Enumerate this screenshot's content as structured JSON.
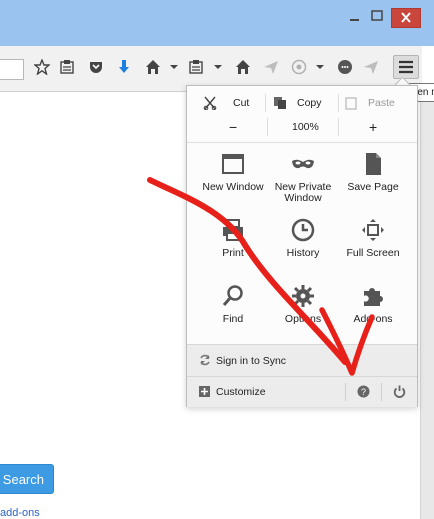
{
  "tooltip": {
    "text": "Open menu"
  },
  "page": {
    "search_button": "Search",
    "addons_link": "add-ons"
  },
  "menu": {
    "edit": {
      "cut": "Cut",
      "copy": "Copy",
      "paste": "Paste"
    },
    "zoom": {
      "minus": "−",
      "level": "100%",
      "plus": "+"
    },
    "items": [
      {
        "label": "New Window",
        "icon": "window-icon"
      },
      {
        "label": "New Private Window",
        "icon": "mask-icon"
      },
      {
        "label": "Save Page",
        "icon": "page-icon"
      },
      {
        "label": "Print",
        "icon": "printer-icon"
      },
      {
        "label": "History",
        "icon": "clock-icon"
      },
      {
        "label": "Full Screen",
        "icon": "fullscreen-icon"
      },
      {
        "label": "Find",
        "icon": "magnifier-icon"
      },
      {
        "label": "Options",
        "icon": "gear-icon"
      },
      {
        "label": "Add-ons",
        "icon": "puzzle-icon"
      }
    ],
    "sync": "Sign in to Sync",
    "customize": "Customize"
  },
  "colors": {
    "titlebar": "#9ac4ef",
    "close": "#c9463d",
    "search": "#3d9be3",
    "annotation": "#e8201a"
  }
}
